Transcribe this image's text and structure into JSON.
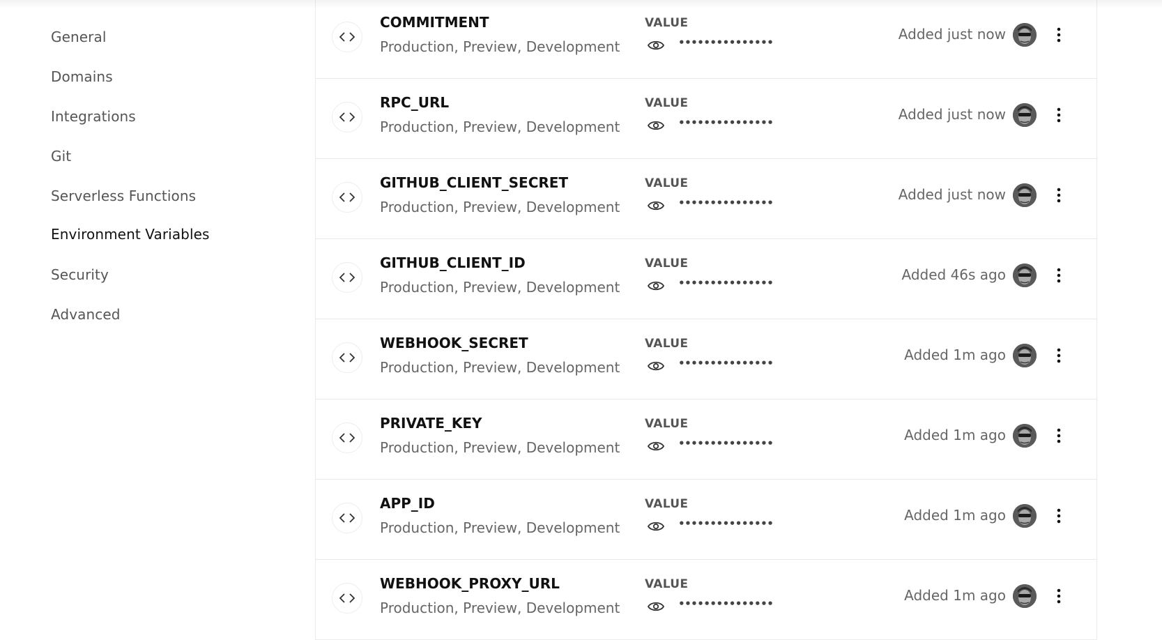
{
  "sidebar": {
    "items": [
      {
        "label": "General"
      },
      {
        "label": "Domains"
      },
      {
        "label": "Integrations"
      },
      {
        "label": "Git"
      },
      {
        "label": "Serverless Functions"
      },
      {
        "label": "Environment Variables",
        "active": true
      },
      {
        "label": "Security"
      },
      {
        "label": "Advanced"
      }
    ]
  },
  "env_vars": {
    "value_label": "VALUE",
    "masked_value": "•••••••••••••••",
    "rows": [
      {
        "name": "COMMITMENT",
        "targets": "Production, Preview, Development",
        "added": "Added just now"
      },
      {
        "name": "RPC_URL",
        "targets": "Production, Preview, Development",
        "added": "Added just now"
      },
      {
        "name": "GITHUB_CLIENT_SECRET",
        "targets": "Production, Preview, Development",
        "added": "Added just now"
      },
      {
        "name": "GITHUB_CLIENT_ID",
        "targets": "Production, Preview, Development",
        "added": "Added 46s ago"
      },
      {
        "name": "WEBHOOK_SECRET",
        "targets": "Production, Preview, Development",
        "added": "Added 1m ago"
      },
      {
        "name": "PRIVATE_KEY",
        "targets": "Production, Preview, Development",
        "added": "Added 1m ago"
      },
      {
        "name": "APP_ID",
        "targets": "Production, Preview, Development",
        "added": "Added 1m ago"
      },
      {
        "name": "WEBHOOK_PROXY_URL",
        "targets": "Production, Preview, Development",
        "added": "Added 1m ago"
      }
    ]
  },
  "icons": {
    "code": "code-brackets-icon",
    "eye": "eye-icon",
    "menu": "more-vertical-icon",
    "avatar": "user-avatar"
  }
}
